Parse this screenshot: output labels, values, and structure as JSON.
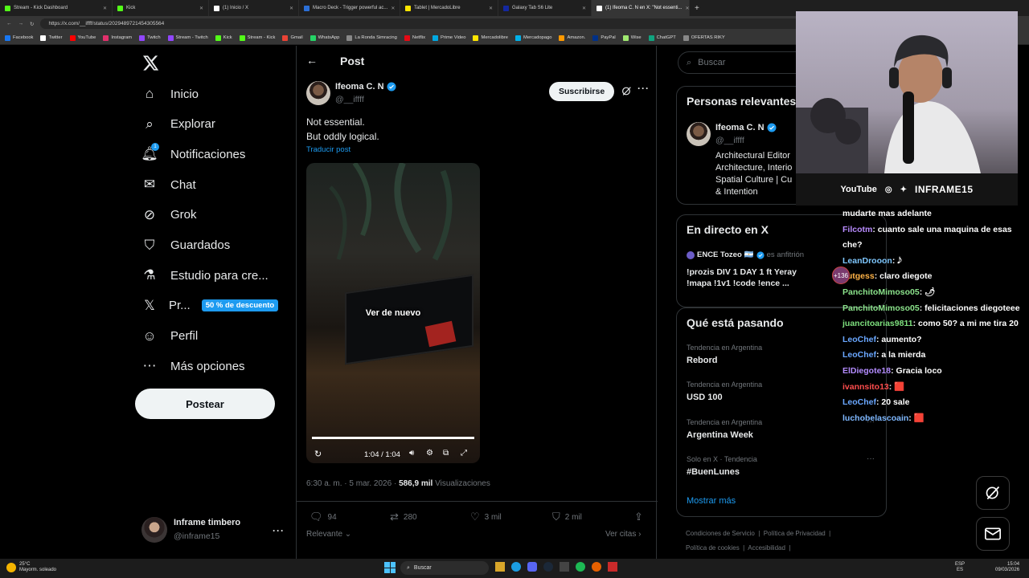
{
  "browser": {
    "tabs": [
      {
        "label": "Stream - Kick Dashboard",
        "color": "#53fc18",
        "active": false
      },
      {
        "label": "Kick",
        "color": "#53fc18",
        "active": false
      },
      {
        "label": "(1) Inicio / X",
        "color": "#ffffff",
        "active": false
      },
      {
        "label": "Macro Deck - Trigger powerful ac...",
        "color": "#2b6fd6",
        "active": false
      },
      {
        "label": "Tablet | MercadoLibre",
        "color": "#ffe600",
        "active": false
      },
      {
        "label": "Galaxy Tab S6 Lite",
        "color": "#1428a0",
        "active": false
      },
      {
        "label": "(1) Ifeoma C. N en X: \"Not essenti...",
        "color": "#ffffff",
        "active": true
      }
    ],
    "url": "https://x.com/__iffff/status/2029489721454305564",
    "bookmarks": [
      {
        "label": "Facebook",
        "color": "#1877f2"
      },
      {
        "label": "Twitter",
        "color": "#ffffff"
      },
      {
        "label": "YouTube",
        "color": "#ff0000"
      },
      {
        "label": "Instagram",
        "color": "#e1306c"
      },
      {
        "label": "Twitch",
        "color": "#9146ff"
      },
      {
        "label": "Stream - Twitch",
        "color": "#9146ff"
      },
      {
        "label": "Kick",
        "color": "#53fc18"
      },
      {
        "label": "Stream - Kick",
        "color": "#53fc18"
      },
      {
        "label": "Gmail",
        "color": "#ea4335"
      },
      {
        "label": "WhatsApp",
        "color": "#25d366"
      },
      {
        "label": "La Ronda Simracing",
        "color": "#888888"
      },
      {
        "label": "Netflix",
        "color": "#e50914"
      },
      {
        "label": "Prime Video",
        "color": "#00a8e1"
      },
      {
        "label": "Mercadolibre",
        "color": "#ffe600"
      },
      {
        "label": "Mercadopago",
        "color": "#00b1ea"
      },
      {
        "label": "Amazon.",
        "color": "#ff9900"
      },
      {
        "label": "PayPal",
        "color": "#003087"
      },
      {
        "label": "Wise",
        "color": "#9fe870"
      },
      {
        "label": "ChatGPT",
        "color": "#10a37f"
      },
      {
        "label": "OFERTAS RIKY",
        "color": "#888888"
      }
    ]
  },
  "nav": {
    "items": [
      {
        "label": "Inicio",
        "icon": "home-icon"
      },
      {
        "label": "Explorar",
        "icon": "search-icon"
      },
      {
        "label": "Notificaciones",
        "icon": "bell-icon",
        "badge": "1"
      },
      {
        "label": "Chat",
        "icon": "mail-icon"
      },
      {
        "label": "Grok",
        "icon": "grok-icon"
      },
      {
        "label": "Guardados",
        "icon": "bookmark-icon"
      },
      {
        "label": "Estudio para cre...",
        "icon": "flask-icon"
      },
      {
        "label": "Pr...",
        "icon": "x-logo-icon",
        "promo": "50 % de descuento"
      },
      {
        "label": "Perfil",
        "icon": "person-icon"
      },
      {
        "label": "Más opciones",
        "icon": "more-circle-icon"
      }
    ],
    "post_button": "Postear",
    "account": {
      "name": "Inframe timbero",
      "handle": "@inframe15"
    }
  },
  "post": {
    "header_title": "Post",
    "author_name": "Ifeoma C. N",
    "author_handle": "@__iffff",
    "subscribe_label": "Suscribirse",
    "text_line1": "Not essential.",
    "text_line2": "But oddly logical.",
    "translate_label": "Traducir post",
    "video": {
      "replay_label": "Ver de nuevo",
      "time": "1:04 / 1:04",
      "progress": 1.0
    },
    "meta_time": "6:30 a. m. · 5 mar. 2026 · ",
    "views_count": "586,9 mil",
    "views_label": " Visualizaciones",
    "replies": "94",
    "reposts": "280",
    "likes": "3 mil",
    "bookmarks": "2 mil",
    "sort_label": "Relevante",
    "quotes_label": "Ver citas"
  },
  "sidebar": {
    "search_placeholder": "Buscar",
    "relevant": {
      "title": "Personas relevantes",
      "name": "Ifeoma C. N",
      "handle": "@__iffff",
      "bio": [
        "Architectural Editor",
        "Architecture, Interio",
        "Spatial Culture | Cu",
        "& Intention"
      ]
    },
    "live": {
      "title": "En directo en X",
      "host": "ENCE Tozeo",
      "host_flag": "🇦🇷",
      "host_role": "es anfitrión",
      "line1": "!prozis DIV 1 DAY 1 ft Yeray",
      "line2": "!mapa !1v1 !code !ence ...",
      "listeners": "+136"
    },
    "trends": {
      "title": "Qué está pasando",
      "items": [
        {
          "category": "Tendencia en Argentina",
          "name": "Rebord"
        },
        {
          "category": "Tendencia en Argentina",
          "name": "USD 100"
        },
        {
          "category": "Tendencia en Argentina",
          "name": "Argentina Week"
        },
        {
          "category": "Solo en X · Tendencia",
          "name": "#BuenLunes"
        }
      ],
      "show_more": "Mostrar más"
    },
    "footer": [
      "Condiciones de Servicio",
      "Política de Privacidad",
      "Política de cookies",
      "Accesibilidad"
    ]
  },
  "stream_overlay": {
    "social_bar": [
      "YouTube",
      "INFRAME15"
    ],
    "chat": [
      {
        "user": "",
        "msg": "mudarte mas adelante",
        "color": "#ffffff"
      },
      {
        "user": "Filcotm",
        "msg": ": cuanto sale una maquina de esas che?",
        "color": "#b98cff"
      },
      {
        "user": "LeanDrooon",
        "msg": ": 𝅘𝅥𝅮",
        "color": "#7fc8ff"
      },
      {
        "user": "Jutgess",
        "msg": ": claro diegote",
        "color": "#ffb347"
      },
      {
        "user": "PanchitoMimoso05",
        "msg": ": 🌶",
        "color": "#8be38b"
      },
      {
        "user": "PanchitoMimoso05",
        "msg": ": felicitaciones diegoteee",
        "color": "#8be38b"
      },
      {
        "user": "juancitoarias9811",
        "msg": ": como 50? a mi me tira 20",
        "color": "#7ee07e"
      },
      {
        "user": "LeoChef",
        "msg": ": aumento?",
        "color": "#6aa7ff"
      },
      {
        "user": "LeoChef",
        "msg": ": a la mierda",
        "color": "#6aa7ff"
      },
      {
        "user": "ElDiegote18",
        "msg": ": Gracia loco",
        "color": "#b48cff"
      },
      {
        "user": "ivannsito13",
        "msg": ": 🟥",
        "color": "#ff4d4d"
      },
      {
        "user": "LeoChef",
        "msg": ": 20 sale",
        "color": "#6aa7ff"
      },
      {
        "user": "luchobelascoain",
        "msg": ": 🟥",
        "color": "#7fb8ff"
      }
    ]
  },
  "taskbar": {
    "weather_temp": "25°C",
    "weather_desc": "Mayorm. soleado",
    "search_label": "Buscar",
    "lang": "ESP",
    "lang2": "ES",
    "time": "15:04",
    "date": "09/03/2026"
  },
  "colors": {
    "accent": "#1d9bf0",
    "bg": "#000000",
    "muted": "#71767b",
    "text": "#e7e9ea"
  }
}
